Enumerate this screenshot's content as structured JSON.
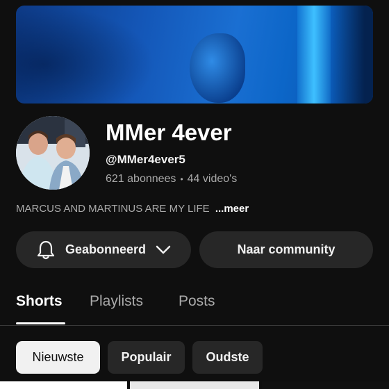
{
  "channel": {
    "name": "MMer 4ever",
    "handle": "@MMer4ever5",
    "subscribers": "621 abonnees",
    "separator": "•",
    "videos": "44 video's",
    "description": "MARCUS AND MARTINUS ARE MY LIFE",
    "more_label": "...meer"
  },
  "actions": {
    "subscribe_label": "Geabonneerd",
    "community_label": "Naar community"
  },
  "tabs": [
    {
      "label": "Shorts",
      "active": true
    },
    {
      "label": "Playlists",
      "active": false
    },
    {
      "label": "Posts",
      "active": false
    }
  ],
  "sort_chips": [
    {
      "label": "Nieuwste",
      "selected": true
    },
    {
      "label": "Populair",
      "selected": false
    },
    {
      "label": "Oudste",
      "selected": false
    }
  ],
  "colors": {
    "background": "#0f0f0f",
    "button": "#272727",
    "chip_selected": "#f1f1f1"
  }
}
